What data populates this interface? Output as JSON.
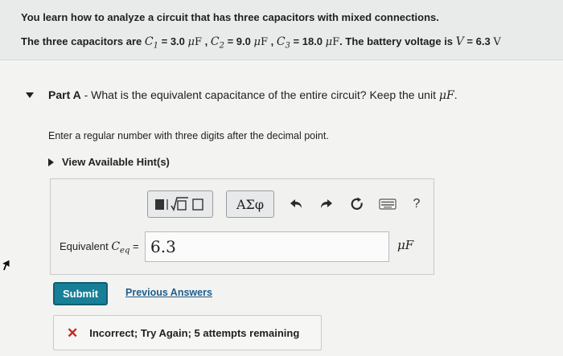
{
  "intro": {
    "line1": "You learn how to analyze a circuit that has three capacitors with mixed connections.",
    "line2_prefix": "The three capacitors are ",
    "c1_symbol": "C",
    "c1_sub": "1",
    "c1_value": "3.0",
    "c2_symbol": "C",
    "c2_sub": "2",
    "c2_value": "9.0",
    "c3_symbol": "C",
    "c3_sub": "3",
    "c3_value": "18.0",
    "unit_mu": "μ",
    "unit_F": "F",
    "battery_text": ". The battery voltage is ",
    "v_symbol": "V",
    "v_value": "6.3",
    "v_unit": "V"
  },
  "part": {
    "label": "Part A",
    "question": " - What is the equivalent capacitance of the entire circuit? Keep the unit ",
    "question_unit": "μF",
    "question_end": "."
  },
  "instruction": "Enter a regular number with three digits after the decimal point.",
  "hints": {
    "label": "View Available Hint(s)"
  },
  "toolbar": {
    "symbols_label": "ΑΣφ",
    "help_label": "?"
  },
  "answer": {
    "label_prefix": "Equivalent ",
    "label_symbol": "C",
    "label_sub": "eq",
    "label_suffix": " = ",
    "value": "6.3",
    "unit": "μF"
  },
  "actions": {
    "submit_label": "Submit",
    "previous_label": "Previous Answers"
  },
  "feedback": {
    "icon": "✕",
    "text": "Incorrect; Try Again; 5 attempts remaining"
  },
  "colors": {
    "submit_bg": "#187f98",
    "link": "#1f5d8c",
    "error": "#c9251d"
  }
}
